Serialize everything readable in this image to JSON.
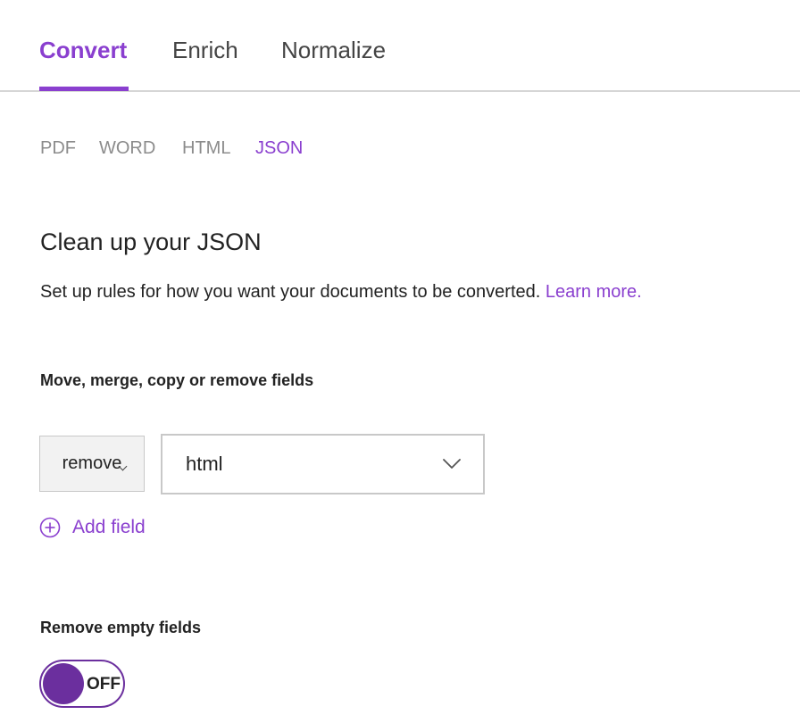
{
  "main_tabs": [
    {
      "label": "Convert",
      "active": true
    },
    {
      "label": "Enrich",
      "active": false
    },
    {
      "label": "Normalize",
      "active": false
    }
  ],
  "sub_tabs": [
    {
      "label": "PDF",
      "active": false
    },
    {
      "label": "WORD",
      "active": false
    },
    {
      "label": "HTML",
      "active": false
    },
    {
      "label": "JSON",
      "active": true
    }
  ],
  "heading": "Clean up your JSON",
  "description": {
    "text": "Set up rules for how you want your documents to be converted.",
    "link": "Learn more."
  },
  "fields_section": {
    "label": "Move, merge, copy or remove fields",
    "operation": "remove",
    "field_value": "html",
    "add_field_label": "Add field"
  },
  "empty_fields_section": {
    "label": "Remove empty fields",
    "toggle_state": "OFF"
  },
  "colors": {
    "accent": "#8a3fcf",
    "toggle": "#6b2f9e",
    "muted": "#8c8c8c"
  },
  "icons": {
    "dropdown": "chevron-down-icon",
    "add": "plus-circle-icon"
  }
}
